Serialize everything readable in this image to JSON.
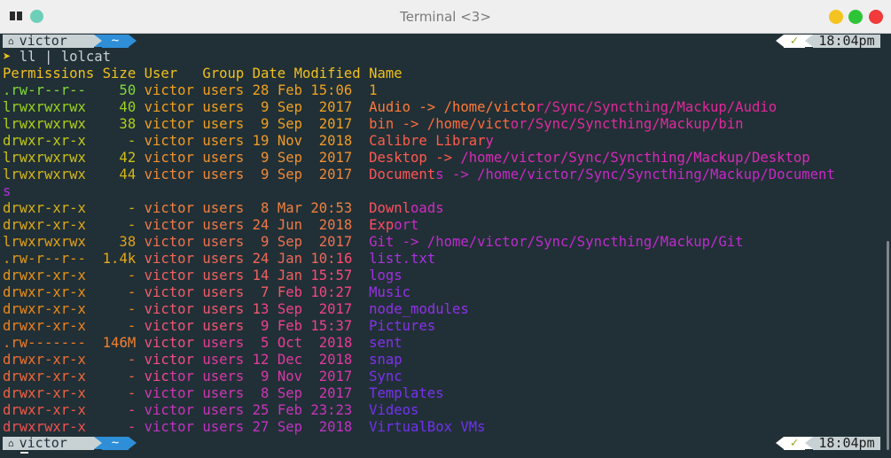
{
  "window": {
    "title": "Terminal <3>"
  },
  "prompt": {
    "user": "victor",
    "dir": "~",
    "check": "✓",
    "time": "18:04pm"
  },
  "command": {
    "symbol": "➤",
    "text": " ll | lolcat"
  },
  "rows": [
    {
      "segs": [
        {
          "t": "Permissions Size User   Group Date Modified Name",
          "c": "#f0c020"
        }
      ]
    },
    {
      "segs": [
        {
          "t": ".rw-r--r--    50 ",
          "c": "#82d93a"
        },
        {
          "t": "victor users 28 Feb 15:06  1",
          "c": "#f0a020"
        }
      ]
    },
    {
      "segs": [
        {
          "t": "lrwxrwxrwx    40 ",
          "c": "#9ad41c"
        },
        {
          "t": "victor users  9 Sep  2017  ",
          "c": "#f0a020"
        },
        {
          "t": "Audio -> /home/victo",
          "c": "#ff7a38"
        },
        {
          "t": "r/Sync/Syncthing/Mackup/Audio",
          "c": "#e0289a"
        }
      ]
    },
    {
      "segs": [
        {
          "t": "lrwxrwxrwx    38 ",
          "c": "#b0cf18"
        },
        {
          "t": "victor users  9 Sep  2017  ",
          "c": "#f0a020"
        },
        {
          "t": "bin -> /home/vict",
          "c": "#ff6a3c"
        },
        {
          "t": "or/Sync/Syncthing/Mackup/bin",
          "c": "#e02aa0"
        }
      ]
    },
    {
      "segs": [
        {
          "t": "drwxr-xr-x     - ",
          "c": "#c0c818"
        },
        {
          "t": "victor users 19 Nov  2018  ",
          "c": "#f09a28"
        },
        {
          "t": "Calibre Librar",
          "c": "#ff5c48"
        },
        {
          "t": "y",
          "c": "#e030a8"
        }
      ]
    },
    {
      "segs": [
        {
          "t": "lrwxrwxrwx    42 ",
          "c": "#cdc018"
        },
        {
          "t": "victor users  9 Sep  2017  ",
          "c": "#f09030"
        },
        {
          "t": "Desktop -> ",
          "c": "#ff5a50"
        },
        {
          "t": "/home/victor/Sync/Syncthing/Mackup/Desktop",
          "c": "#d82ab8"
        }
      ]
    },
    {
      "segs": [
        {
          "t": "lrwxrwxrwx    44 ",
          "c": "#d6b618"
        },
        {
          "t": "victor users  9 Sep  2017  ",
          "c": "#f08838"
        },
        {
          "t": "Document",
          "c": "#ff5458"
        },
        {
          "t": "s -> /home/victor/Sync/Syncthing/Mackup/Document",
          "c": "#c828c8"
        }
      ]
    },
    {
      "segs": [
        {
          "t": "s",
          "c": "#b030d8"
        }
      ]
    },
    {
      "segs": [
        {
          "t": "drwxr-xr-x     - ",
          "c": "#d8b018"
        },
        {
          "t": "victor users  8 Mar 20:53  ",
          "c": "#f08040"
        },
        {
          "t": "Downl",
          "c": "#ff5060"
        },
        {
          "t": "oads",
          "c": "#d02cc0"
        }
      ]
    },
    {
      "segs": [
        {
          "t": "drwxr-xr-x     - ",
          "c": "#e0a818"
        },
        {
          "t": "victor users 24 Jun  2018  ",
          "c": "#f07848"
        },
        {
          "t": "Exp",
          "c": "#ff4c68"
        },
        {
          "t": "ort",
          "c": "#c82cc8"
        }
      ]
    },
    {
      "segs": [
        {
          "t": "lrwxrwxrwx    38 ",
          "c": "#e2a018"
        },
        {
          "t": "victor users  9 Sep  2017  ",
          "c": "#f07050"
        },
        {
          "t": "Git -> /home/victor/Sync/Syncthing/Mackup/Git",
          "c": "#c02ad0"
        }
      ]
    },
    {
      "segs": [
        {
          "t": ".rw-r--r--  ",
          "c": "#e69a18"
        },
        {
          "t": "1.4k ",
          "c": "#e8a818"
        },
        {
          "t": "victor users 24 Jan 10:",
          "c": "#f06858"
        },
        {
          "t": "16  ",
          "c": "#ff4a70"
        },
        {
          "t": "list.txt",
          "c": "#a832e0"
        }
      ]
    },
    {
      "segs": [
        {
          "t": "drwxr-xr-x     - ",
          "c": "#e89418"
        },
        {
          "t": "victor users 14 Jan ",
          "c": "#f06060"
        },
        {
          "t": "15:57  ",
          "c": "#ff4878"
        },
        {
          "t": "logs",
          "c": "#a030e0"
        }
      ]
    },
    {
      "segs": [
        {
          "t": "drwxr-xr-x     - ",
          "c": "#ea8e18"
        },
        {
          "t": "victor users  7 F",
          "c": "#f05c68"
        },
        {
          "t": "eb 10:27  ",
          "c": "#f84480"
        },
        {
          "t": "Music",
          "c": "#9830e8"
        }
      ]
    },
    {
      "segs": [
        {
          "t": "drwxr-xr-x     - ",
          "c": "#ec8818"
        },
        {
          "t": "victor users 1",
          "c": "#f05870"
        },
        {
          "t": "3 Sep  2017  ",
          "c": "#f04288"
        },
        {
          "t": "node_modules",
          "c": "#9030e8"
        }
      ]
    },
    {
      "segs": [
        {
          "t": "drwxr-xr-x     - ",
          "c": "#ee8020"
        },
        {
          "t": "victor users  ",
          "c": "#f05478"
        },
        {
          "t": "9 Feb 15:37  ",
          "c": "#ee4090"
        },
        {
          "t": "Pictures",
          "c": "#8830ee"
        }
      ]
    },
    {
      "segs": [
        {
          "t": ".rw-------  ",
          "c": "#f07a28"
        },
        {
          "t": "146M ",
          "c": "#f08030"
        },
        {
          "t": "victor ",
          "c": "#f05080"
        },
        {
          "t": "users  5 Oct  2018  ",
          "c": "#e83c98"
        },
        {
          "t": "sent",
          "c": "#8430ee"
        }
      ]
    },
    {
      "segs": [
        {
          "t": "drwxr-xr-x     - ",
          "c": "#f07030"
        },
        {
          "t": "victor ",
          "c": "#f04c88"
        },
        {
          "t": "users 12 Dec  2018  ",
          "c": "#e03aa0"
        },
        {
          "t": "snap",
          "c": "#8030f0"
        }
      ]
    },
    {
      "segs": [
        {
          "t": "drwxr-xr-x     - ",
          "c": "#f06838"
        },
        {
          "t": "vic",
          "c": "#f04890"
        },
        {
          "t": "tor users  9 Nov  2017  ",
          "c": "#d838a8"
        },
        {
          "t": "Sync",
          "c": "#7c30f0"
        }
      ]
    },
    {
      "segs": [
        {
          "t": "drwxr-xr-x     - ",
          "c": "#f06040"
        },
        {
          "t": "victor users  8 Sep  2017  ",
          "c": "#d036b4"
        },
        {
          "t": "Templates",
          "c": "#7830f0"
        }
      ]
    },
    {
      "segs": [
        {
          "t": "drwxr-xr-x     ",
          "c": "#f05848"
        },
        {
          "t": "- ",
          "c": "#f0448c"
        },
        {
          "t": "victor users 25 Feb 23:23  ",
          "c": "#c834bc"
        },
        {
          "t": "Videos",
          "c": "#7430f2"
        }
      ]
    },
    {
      "segs": [
        {
          "t": "drwxrwxr-x    ",
          "c": "#f05050"
        },
        {
          "t": " - ",
          "c": "#e84098"
        },
        {
          "t": "victor users 27 Sep  2018  ",
          "c": "#c032c4"
        },
        {
          "t": "VirtualBox VMs",
          "c": "#7030f2"
        }
      ]
    }
  ]
}
